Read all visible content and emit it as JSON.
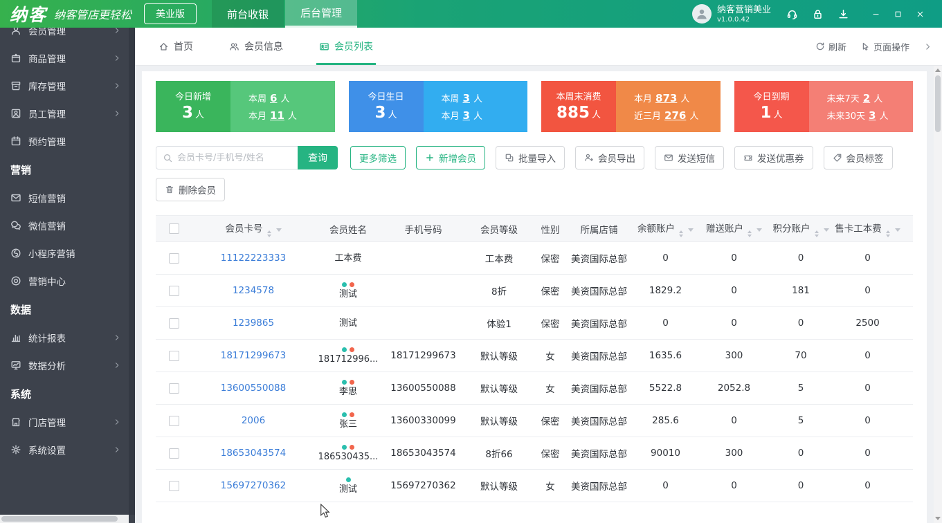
{
  "topbar": {
    "logo": "纳客",
    "tagline": "纳客管店更轻松",
    "edition_button": "美业版",
    "nav_tabs": [
      {
        "label": "前台收银",
        "active": false
      },
      {
        "label": "后台管理",
        "active": true
      }
    ],
    "user": {
      "name": "纳客营销美业",
      "version": "v1.0.0.42"
    },
    "action_icons": [
      {
        "name": "support-icon"
      },
      {
        "name": "lock-icon"
      },
      {
        "name": "download-icon"
      }
    ],
    "window_controls": [
      {
        "name": "minimize-button",
        "icon": "minimize-icon"
      },
      {
        "name": "maximize-button",
        "icon": "maximize-icon"
      },
      {
        "name": "close-button",
        "icon": "close-icon"
      }
    ]
  },
  "sidebar": {
    "items": [
      {
        "label": "会员管理",
        "icon": "member-icon",
        "chevron": true,
        "clipped": true
      },
      {
        "label": "商品管理",
        "icon": "goods-icon",
        "chevron": true
      },
      {
        "label": "库存管理",
        "icon": "stock-icon",
        "chevron": true
      },
      {
        "label": "员工管理",
        "icon": "staff-icon",
        "chevron": true
      },
      {
        "label": "预约管理",
        "icon": "calendar-icon",
        "chevron": false
      },
      {
        "label": "营销",
        "header": true
      },
      {
        "label": "短信营销",
        "icon": "sms-icon",
        "chevron": false
      },
      {
        "label": "微信营销",
        "icon": "wechat-icon",
        "chevron": false
      },
      {
        "label": "小程序营销",
        "icon": "miniprogram-icon",
        "chevron": false
      },
      {
        "label": "营销中心",
        "icon": "target-icon",
        "chevron": false
      },
      {
        "label": "数据",
        "header": true
      },
      {
        "label": "统计报表",
        "icon": "report-icon",
        "chevron": true
      },
      {
        "label": "数据分析",
        "icon": "analysis-icon",
        "chevron": true
      },
      {
        "label": "系统",
        "header": true
      },
      {
        "label": "门店管理",
        "icon": "store-icon",
        "chevron": true
      },
      {
        "label": "系统设置",
        "icon": "settings-icon",
        "chevron": true
      }
    ]
  },
  "page_tabs": {
    "tabs": [
      {
        "label": "首页",
        "icon": "home-icon",
        "active": false
      },
      {
        "label": "会员信息",
        "icon": "members-icon",
        "active": false
      },
      {
        "label": "会员列表",
        "icon": "member-list-icon",
        "active": true
      }
    ],
    "actions": [
      {
        "label": "刷新",
        "icon": "refresh-icon",
        "name": "refresh-button"
      },
      {
        "label": "页面操作",
        "icon": "page-ops-icon",
        "name": "page-operations-button"
      }
    ]
  },
  "stats_cards": [
    {
      "name": "today-new-members",
      "main_label": "今日新增",
      "main_value": "3",
      "unit": "人",
      "left_color": "#3ab55c",
      "right_color": "#56c77b",
      "rows": [
        {
          "label": "本周",
          "value": "6",
          "unit": "人"
        },
        {
          "label": "本月",
          "value": "11",
          "unit": "人"
        }
      ]
    },
    {
      "name": "today-birthdays",
      "main_label": "今日生日",
      "main_value": "3",
      "unit": "人",
      "left_color": "#3f90e8",
      "right_color": "#32adf0",
      "rows": [
        {
          "label": "本周",
          "value": "3",
          "unit": "人"
        },
        {
          "label": "本月",
          "value": "3",
          "unit": "人"
        }
      ]
    },
    {
      "name": "week-no-consumption",
      "main_label": "本周末消费",
      "main_value": "885",
      "unit": "人",
      "left_color": "#f25540",
      "right_color": "#f08948",
      "rows": [
        {
          "label": "本月",
          "value": "873",
          "unit": "人"
        },
        {
          "label": "近三月",
          "value": "276",
          "unit": "人"
        }
      ]
    },
    {
      "name": "today-expiring",
      "main_label": "今日到期",
      "main_value": "1",
      "unit": "人",
      "left_color": "#f4574b",
      "right_color": "#f47f75",
      "rows": [
        {
          "label": "未来7天",
          "value": "2",
          "unit": "人"
        },
        {
          "label": "未来30天",
          "value": "3",
          "unit": "人"
        }
      ]
    }
  ],
  "toolbar": {
    "search_placeholder": "会员卡号/手机号/姓名",
    "search_button": "查询",
    "buttons": [
      {
        "label": "更多筛选",
        "style": "green-outline",
        "name": "more-filter-button"
      },
      {
        "label": "新增会员",
        "style": "green-outline",
        "icon": "plus-icon",
        "name": "add-member-button"
      },
      {
        "label": "批量导入",
        "style": "default",
        "icon": "import-icon",
        "name": "batch-import-button"
      },
      {
        "label": "会员导出",
        "style": "default",
        "icon": "export-icon",
        "name": "member-export-button"
      },
      {
        "label": "发送短信",
        "style": "default",
        "icon": "mail-icon",
        "name": "send-sms-button"
      },
      {
        "label": "发送优惠券",
        "style": "default",
        "icon": "coupon-icon",
        "name": "send-coupon-button"
      },
      {
        "label": "会员标签",
        "style": "default",
        "icon": "tag-icon",
        "name": "member-tag-button"
      }
    ],
    "delete_button": {
      "label": "删除会员",
      "icon": "trash-icon",
      "name": "delete-member-button"
    }
  },
  "table": {
    "columns": [
      {
        "label": "",
        "type": "checkbox",
        "width": 52
      },
      {
        "label": "会员卡号",
        "sortable": true,
        "width": 178
      },
      {
        "label": "会员姓名",
        "sortable": false,
        "width": 96
      },
      {
        "label": "手机号码",
        "sortable": false,
        "width": 121
      },
      {
        "label": "会员等级",
        "sortable": false,
        "width": 98
      },
      {
        "label": "性别",
        "sortable": false,
        "width": 50
      },
      {
        "label": "所属店铺",
        "sortable": false,
        "width": 91
      },
      {
        "label": "余额账户",
        "sortable": true,
        "width": 101
      },
      {
        "label": "赠送账户",
        "sortable": true,
        "width": 97
      },
      {
        "label": "积分账户",
        "sortable": true,
        "width": 96
      },
      {
        "label": "售卡工本费",
        "sortable": true,
        "width": 97
      },
      {
        "label": "",
        "type": "filler",
        "width": 0
      }
    ],
    "rows": [
      {
        "card": "11122223333",
        "name": "工本费",
        "dots": [],
        "phone": "",
        "level": "工本费",
        "gender": "保密",
        "store": "美资国际总部",
        "balance": "0",
        "gift": "0",
        "points": "0",
        "card_fee": "0"
      },
      {
        "card": "1234578",
        "name": "测试",
        "dots": [
          "teal",
          "red"
        ],
        "phone": "",
        "level": "8折",
        "gender": "保密",
        "store": "美资国际总部",
        "balance": "1829.2",
        "gift": "0",
        "points": "181",
        "card_fee": "0"
      },
      {
        "card": "1239865",
        "name": "测试",
        "dots": [],
        "phone": "",
        "level": "体验1",
        "gender": "保密",
        "store": "美资国际总部",
        "balance": "0",
        "gift": "0",
        "points": "0",
        "card_fee": "2500"
      },
      {
        "card": "18171299673",
        "name": "181712996...",
        "dots": [
          "teal",
          "red"
        ],
        "phone": "18171299673",
        "level": "默认等级",
        "gender": "女",
        "store": "美资国际总部",
        "balance": "1635.6",
        "gift": "300",
        "points": "70",
        "card_fee": "0"
      },
      {
        "card": "13600550088",
        "name": "李思",
        "dots": [
          "teal",
          "red"
        ],
        "phone": "13600550088",
        "level": "默认等级",
        "gender": "女",
        "store": "美资国际总部",
        "balance": "5522.8",
        "gift": "2052.8",
        "points": "5",
        "card_fee": "0"
      },
      {
        "card": "2006",
        "name": "张三",
        "dots": [
          "teal",
          "red"
        ],
        "phone": "13600330099",
        "level": "默认等级",
        "gender": "保密",
        "store": "美资国际总部",
        "balance": "285.6",
        "gift": "0",
        "points": "5",
        "card_fee": "0"
      },
      {
        "card": "18653043574",
        "name": "186530435...",
        "dots": [
          "teal",
          "red"
        ],
        "phone": "18653043574",
        "level": "8折66",
        "gender": "保密",
        "store": "美资国际总部",
        "balance": "90010",
        "gift": "300",
        "points": "0",
        "card_fee": "0"
      },
      {
        "card": "15697270362",
        "name": "测试",
        "dots": [
          "teal"
        ],
        "phone": "15697270362",
        "level": "默认等级",
        "gender": "女",
        "store": "美资国际总部",
        "balance": "0",
        "gift": "0",
        "points": "0",
        "card_fee": "0"
      }
    ]
  },
  "colors": {
    "accent": "#26b482",
    "link": "#3b7dd8",
    "dots": {
      "teal": "#2bbfae",
      "red": "#f2654c"
    },
    "sidebar_bg": "#3d424c"
  }
}
